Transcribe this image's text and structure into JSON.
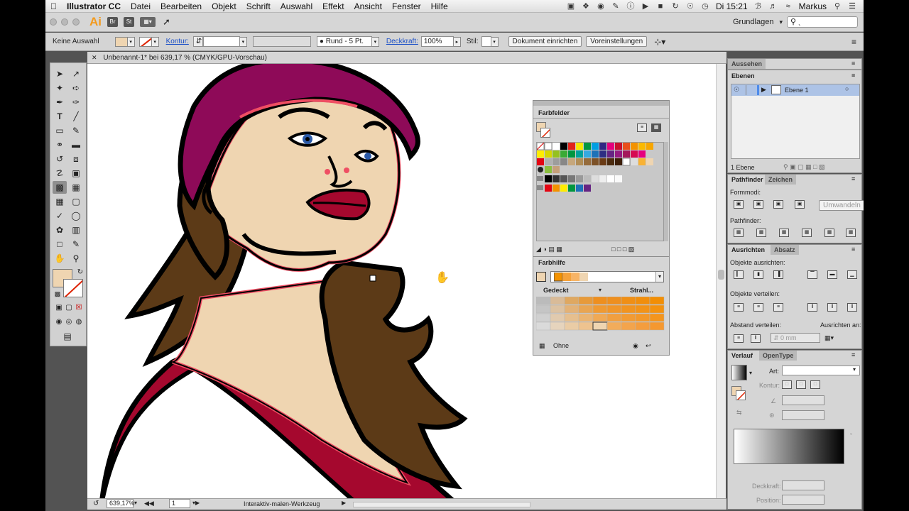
{
  "menubar": {
    "apple": "",
    "app": "Illustrator CC",
    "items": [
      "Datei",
      "Bearbeiten",
      "Objekt",
      "Schrift",
      "Auswahl",
      "Effekt",
      "Ansicht",
      "Fenster",
      "Hilfe"
    ],
    "clock": "Di 15:21",
    "user": "Markus"
  },
  "appbar": {
    "logo": "Ai",
    "bridge": "Br",
    "stock": "St",
    "workspace": "Grundlagen",
    "search_placeholder": "ˎ"
  },
  "control": {
    "selection": "Keine Auswahl",
    "kontur_label": "Kontur:",
    "brush": "Rund - 5 Pt.",
    "opacity_label": "Deckkraft:",
    "opacity_value": "100%",
    "style_label": "Stil:",
    "doc_setup": "Dokument einrichten",
    "prefs": "Voreinstellungen"
  },
  "document": {
    "tab": "Unbenannt-1* bei 639,17 % (CMYK/GPU-Vorschau)"
  },
  "status": {
    "zoom": "639,17%",
    "page": "1",
    "tool": "Interaktiv-malen-Werkzeug"
  },
  "farbfelder": {
    "title": "Farbfelder"
  },
  "farbhilfe": {
    "title": "Farbhilfe",
    "left_label": "Gedeckt",
    "right_label": "Strahl...",
    "footer": "Ohne"
  },
  "aussehen": {
    "title": "Aussehen"
  },
  "ebenen": {
    "title": "Ebenen",
    "layer_name": "Ebene 1",
    "count": "1 Ebene"
  },
  "pathfinder": {
    "tab1": "Pathfinder",
    "tab2": "Zeichen",
    "formmodi": "Formmodi:",
    "umwandeln": "Umwandeln",
    "pathfinder_label": "Pathfinder:"
  },
  "ausrichten": {
    "tab1": "Ausrichten",
    "tab2": "Absatz",
    "objects_align": "Objekte ausrichten:",
    "objects_distribute": "Objekte verteilen:",
    "spacing": "Abstand verteilen:",
    "align_to": "Ausrichten an:",
    "mm": "0 mm"
  },
  "verlauf": {
    "tab1": "Verlauf",
    "tab2": "OpenType",
    "art": "Art:",
    "kontur": "Kontur:",
    "deckkraft": "Deckkraft:",
    "position": "Position:"
  },
  "colors": {
    "skin": "#efd5b1",
    "hair": "#5c3a17",
    "hat": "#8e0a58",
    "shirt": "#a5082e",
    "outline": "#ef4e63"
  }
}
